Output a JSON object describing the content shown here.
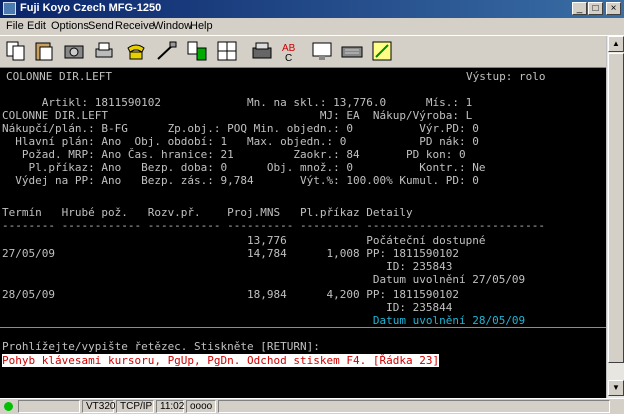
{
  "window": {
    "title": "Fuji Koyo Czech MFG-1250"
  },
  "menu": [
    "File",
    "Edit",
    "Options",
    "Send",
    "Receive",
    "Window",
    "Help"
  ],
  "toolbar": [
    "copy-icon",
    "paste-icon",
    "camera-icon",
    "print-icon",
    "phone-icon",
    "cable-icon",
    "transfer-icon",
    "layout-icon",
    "printer-settings-icon",
    "spell-check-icon",
    "monitor-icon",
    "keyboard-icon",
    "exit-icon"
  ],
  "terminal": {
    "header_left": "COLONNE DIR.LEFT",
    "header_right": "Výstup: rolo",
    "lines": [
      "      Artikl: 1811590102             Mn. na skl.: 13,776.0      Mís.: 1",
      "COLONNE DIR.LEFT                                MJ: EA  Nákup/Výroba: L",
      "Nákupčí/plán.: B-FG      Zp.obj.: POQ Min. objedn.: 0          Výr.PD: 0",
      "  Hlavní plán: Ano  Obj. období: 1   Max. objedn.: 0           PD nák: 0",
      "   Požad. MRP: Ano Čas. hranice: 21         Zaokr.: 84       PD kon: 0",
      "    Pl.příkaz: Ano   Bezp. doba: 0      Obj. množ.: 0          Kontr.: Ne",
      "  Výdej na PP: Ano   Bezp. zás.: 9,784       Výt.%: 100.00% Kumul. PD: 0",
      "",
      "Termín   Hrubé pož.   Rozv.př.    Proj.MNS   Pl.příkaz Detaily",
      "-------- ------------ ----------- ---------- --------- ---------------------------",
      "                                     13,776            Počáteční dostupné",
      "27/05/09                             14,784      1,008 PP: 1811590102",
      "                                                          ID: 235843",
      "                                                        Datum uvolnění 27/05/09",
      "28/05/09                             18,984      4,200 PP: 1811590102",
      "                                                          ID: 235844"
    ],
    "highlight_line": "                                                        Datum uvolnění 28/05/09",
    "prompt": "Prohlížejte/vypište řetězec. Stiskněte [RETURN]:",
    "help": "Pohyb klávesami kursoru, PgUp, PgDn. Odchod stiskem F4. [Řádka 23]"
  },
  "status": {
    "terminal_type": "VT320",
    "protocol": "TCP/IP",
    "time": "11:02",
    "indicators": "oooo"
  },
  "colors": {
    "screen_bg": "#000000",
    "text": "#c0c0c0",
    "highlight": "#1fb5d6",
    "error": "#d00000"
  }
}
